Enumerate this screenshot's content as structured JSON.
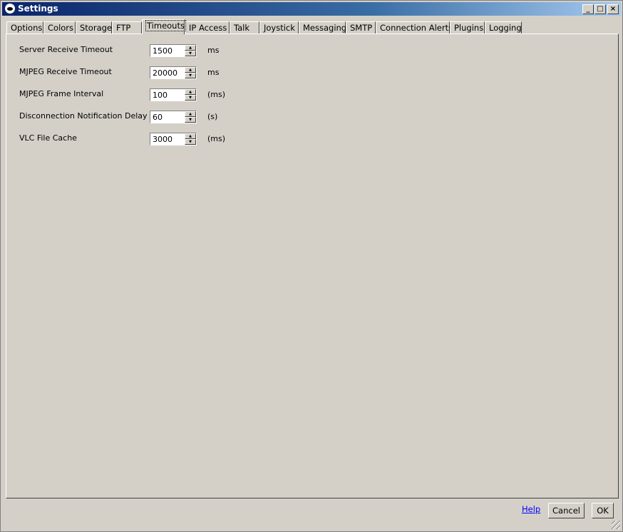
{
  "window": {
    "title": "Settings"
  },
  "title_buttons": {
    "minimize": "_",
    "maximize": "□",
    "close": "×"
  },
  "tabs": [
    {
      "label": "Options"
    },
    {
      "label": "Colors"
    },
    {
      "label": "Storage"
    },
    {
      "label": "FTP"
    },
    {
      "label": "Timeouts",
      "active": true
    },
    {
      "label": "IP Access"
    },
    {
      "label": "Talk"
    },
    {
      "label": "Joystick"
    },
    {
      "label": "Messaging"
    },
    {
      "label": "SMTP"
    },
    {
      "label": "Connection Alerts"
    },
    {
      "label": "Plugins"
    },
    {
      "label": "Logging"
    }
  ],
  "timeouts": [
    {
      "label": "Server Receive Timeout",
      "value": "1500",
      "unit": "ms"
    },
    {
      "label": "MJPEG Receive Timeout",
      "value": "20000",
      "unit": "ms"
    },
    {
      "label": "MJPEG Frame Interval",
      "value": "100",
      "unit": "(ms)"
    },
    {
      "label": "Disconnection Notification Delay",
      "value": "60",
      "unit": "(s)"
    },
    {
      "label": "VLC File Cache",
      "value": "3000",
      "unit": "(ms)"
    }
  ],
  "footer": {
    "help": "Help",
    "cancel": "Cancel",
    "ok": "OK"
  }
}
